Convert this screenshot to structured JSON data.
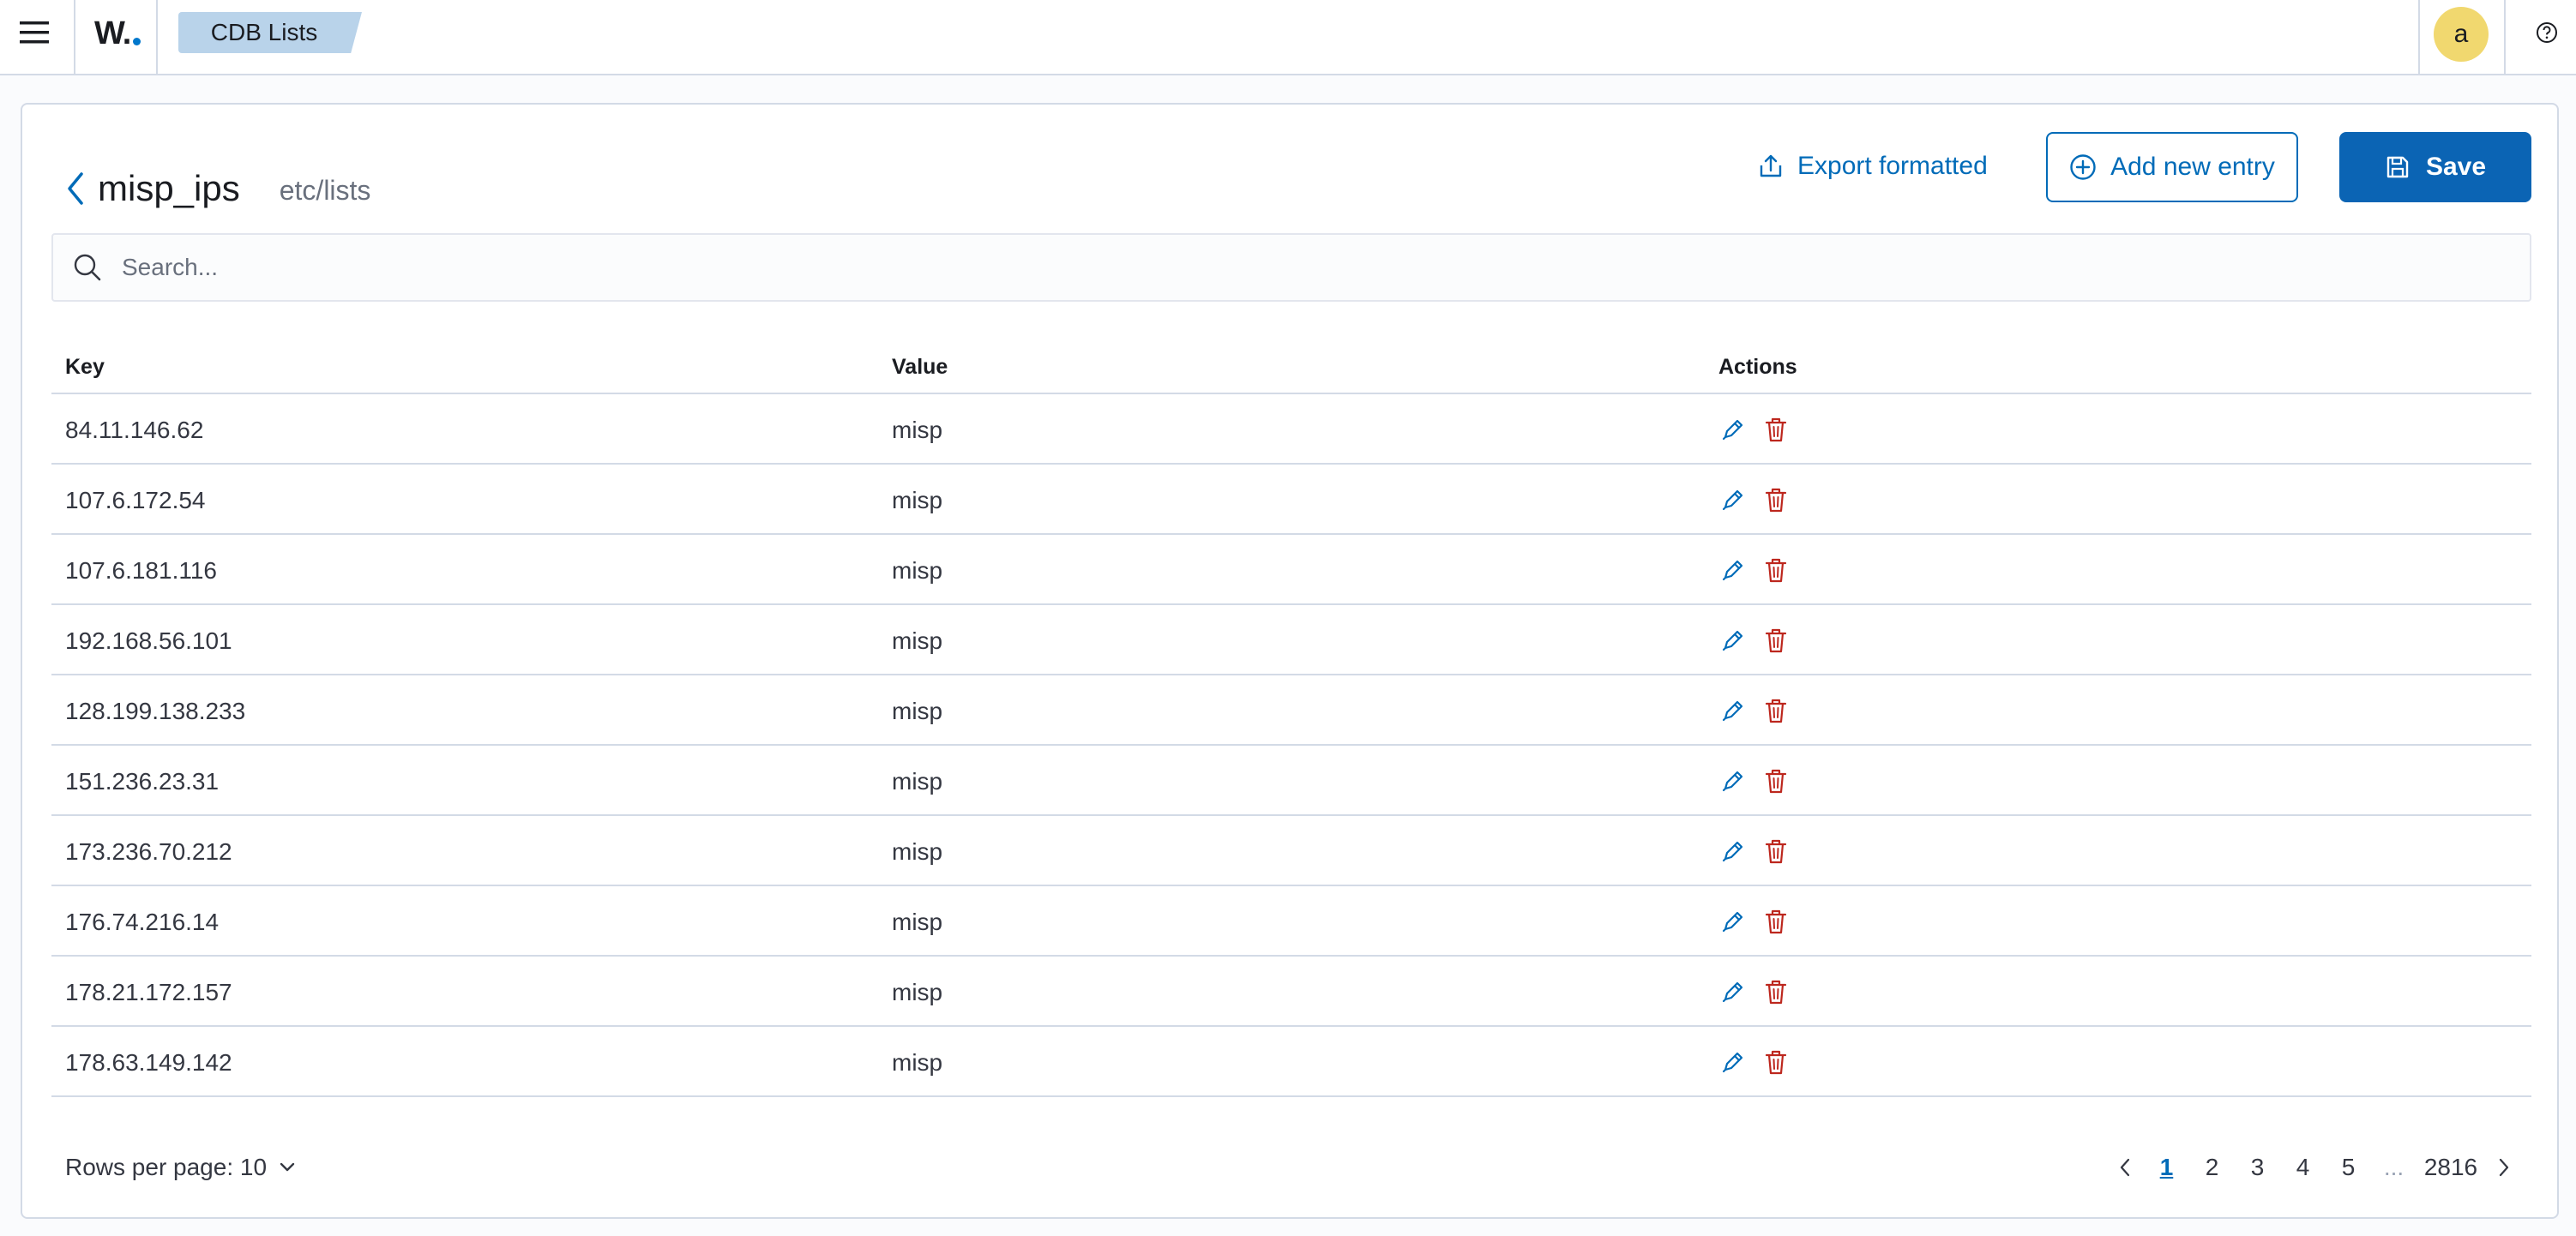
{
  "header": {
    "logo_text": "W.",
    "breadcrumb": "CDB Lists",
    "avatar_letter": "a",
    "accent_color": "#006bb8"
  },
  "list": {
    "name": "misp_ips",
    "path": "etc/lists"
  },
  "toolbar": {
    "export_label": "Export formatted",
    "add_label": "Add new entry",
    "save_label": "Save"
  },
  "search": {
    "placeholder": "Search...",
    "value": ""
  },
  "table": {
    "columns": [
      "Key",
      "Value",
      "Actions"
    ],
    "rows": [
      {
        "key": "84.11.146.62",
        "value": "misp"
      },
      {
        "key": "107.6.172.54",
        "value": "misp"
      },
      {
        "key": "107.6.181.116",
        "value": "misp"
      },
      {
        "key": "192.168.56.101",
        "value": "misp"
      },
      {
        "key": "128.199.138.233",
        "value": "misp"
      },
      {
        "key": "151.236.23.31",
        "value": "misp"
      },
      {
        "key": "173.236.70.212",
        "value": "misp"
      },
      {
        "key": "176.74.216.14",
        "value": "misp"
      },
      {
        "key": "178.21.172.157",
        "value": "misp"
      },
      {
        "key": "178.63.149.142",
        "value": "misp"
      }
    ]
  },
  "pagination": {
    "rows_per_page_label": "Rows per page: 10",
    "pages": [
      "1",
      "2",
      "3",
      "4",
      "5"
    ],
    "ellipsis": "...",
    "last_page": "2816",
    "current_page": "1"
  },
  "icons": {
    "menu": "hamburger-icon",
    "help": "help-icon",
    "back": "chevron-left-icon",
    "export": "export-icon",
    "add": "plus-circle-icon",
    "save": "save-icon",
    "search": "search-icon",
    "edit": "pencil-icon",
    "delete": "trash-icon"
  }
}
